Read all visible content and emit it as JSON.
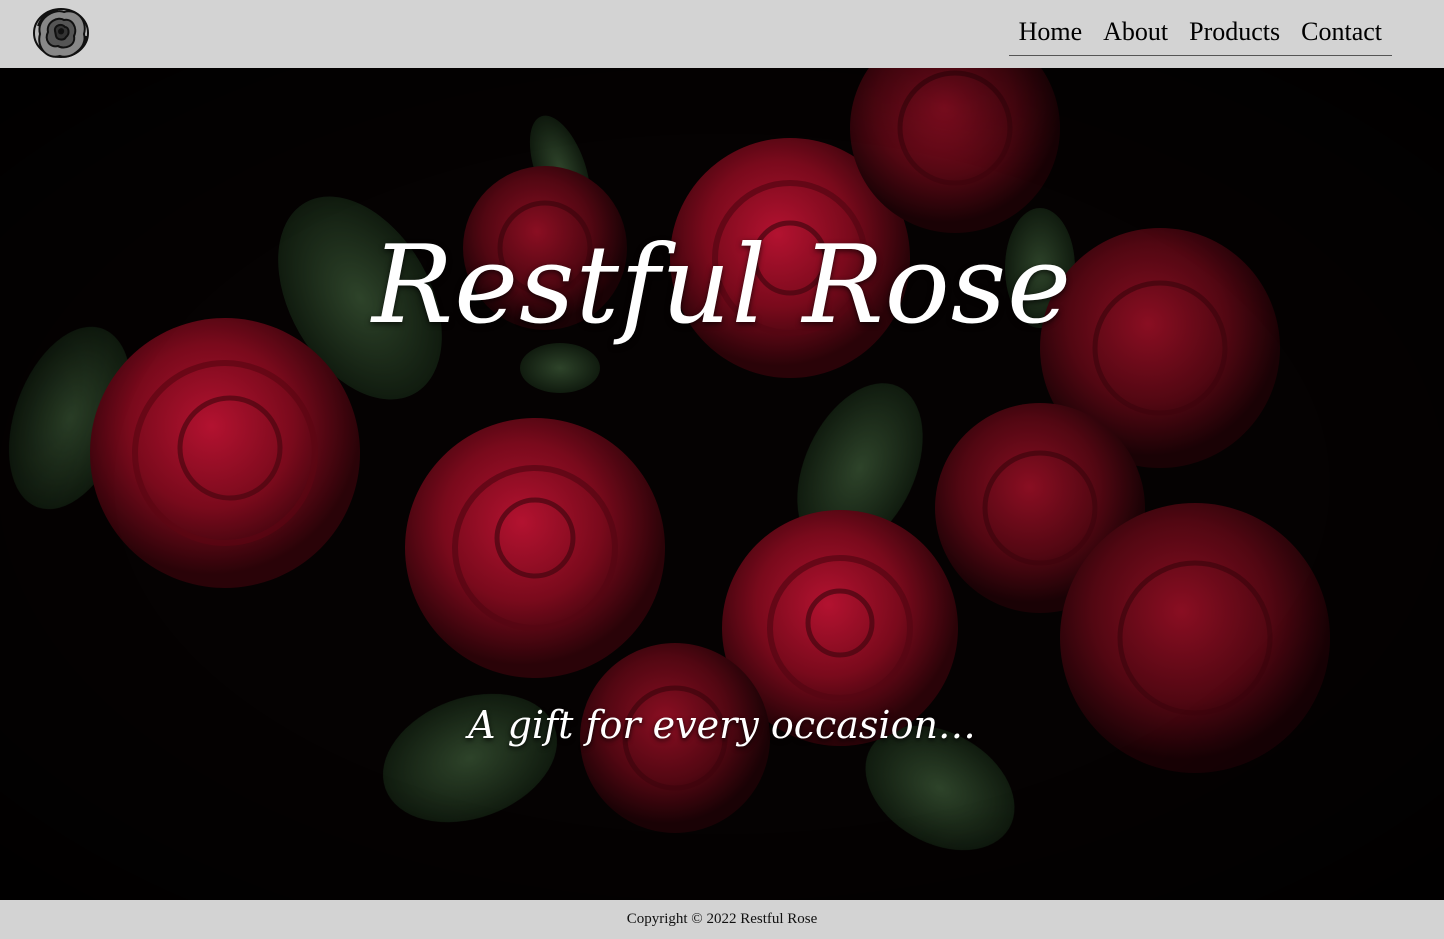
{
  "header": {
    "logo_icon": "rose-icon",
    "nav": [
      {
        "label": "Home"
      },
      {
        "label": "About"
      },
      {
        "label": "Products"
      },
      {
        "label": "Contact"
      }
    ]
  },
  "hero": {
    "title": "Restful Rose",
    "tagline": "A gift for every occasion…",
    "background_image": "dark red roses on black background",
    "colors": {
      "rose": "#8c0a1e",
      "leaf": "#1e3a1e",
      "background": "#040202"
    }
  },
  "footer": {
    "copyright": "Copyright © 2022 Restful Rose"
  },
  "colors": {
    "bar_background": "#d3d3d3",
    "text_light": "#ffffff"
  }
}
